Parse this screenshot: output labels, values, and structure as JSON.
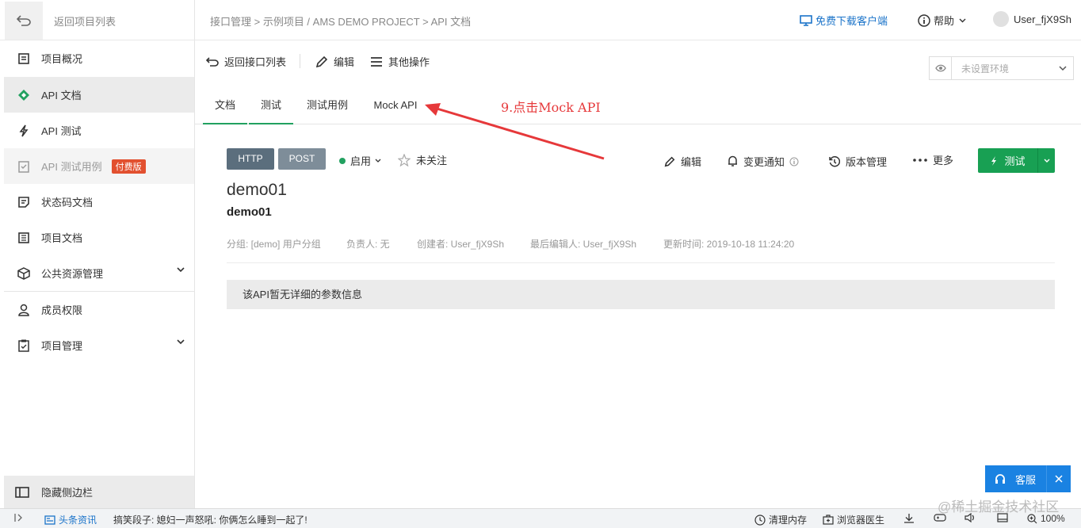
{
  "sidebar": {
    "back_label": "返回项目列表",
    "items": [
      {
        "label": "项目概况",
        "icon": "overview-icon"
      },
      {
        "label": "API 文档",
        "icon": "api-doc-icon"
      },
      {
        "label": "API 测试",
        "icon": "lightning-icon"
      },
      {
        "label": "API 测试用例",
        "icon": "testcase-icon",
        "badge": "付费版"
      },
      {
        "label": "状态码文档",
        "icon": "status-code-icon"
      },
      {
        "label": "项目文档",
        "icon": "project-doc-icon"
      },
      {
        "label": "公共资源管理",
        "icon": "cube-icon"
      },
      {
        "label": "成员权限",
        "icon": "member-icon"
      },
      {
        "label": "项目管理",
        "icon": "clipboard-icon"
      }
    ],
    "hide_label": "隐藏侧边栏"
  },
  "header": {
    "breadcrumb": "接口管理 > 示例项目 / AMS DEMO PROJECT > API 文档",
    "download": "免费下载客户端",
    "help": "帮助",
    "user": "User_fjX9Sh"
  },
  "toolbar": {
    "back": "返回接口列表",
    "edit": "编辑",
    "more_ops": "其他操作",
    "env_placeholder": "未设置环境"
  },
  "tabs": [
    "文档",
    "测试",
    "测试用例",
    "Mock API"
  ],
  "annotation": "9.点击Mock API",
  "api": {
    "protocol": "HTTP",
    "method": "POST",
    "status": "启用",
    "follow": "未关注",
    "actions": {
      "edit": "编辑",
      "notify": "变更通知",
      "version": "版本管理",
      "more": "更多"
    },
    "test_button": "测试",
    "title": "demo01",
    "subtitle": "demo01",
    "meta": {
      "group": "分组: [demo] 用户分组",
      "owner": "负责人: 无",
      "creator": "创建者: User_fjX9Sh",
      "last_editor": "最后编辑人: User_fjX9Sh",
      "updated": "更新时间: 2019-10-18 11:24:20"
    },
    "empty_message": "该API暂无详细的参数信息"
  },
  "customer_service": "客服",
  "statusbar": {
    "news": "头条资讯",
    "headline": "搞笑段子: 媳妇一声怒吼: 你俩怎么睡到一起了!",
    "clean_memory": "清理内存",
    "browser_doctor": "浏览器医生",
    "zoom": "100%"
  },
  "watermark": "@稀土掘金技术社区",
  "colors": {
    "accent": "#22a160",
    "link": "#1a73c9",
    "annotation": "#e6383a",
    "badge": "#e2502f"
  }
}
